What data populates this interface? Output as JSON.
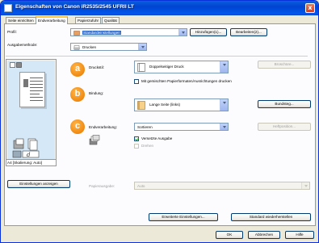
{
  "window": {
    "title": "Eigenschaften von Canon iR2535/2545 UFRII LT",
    "close_label": "x"
  },
  "tabs": [
    {
      "label": "Seite einrichten",
      "active": false
    },
    {
      "label": "Endverarbeitung",
      "active": true
    },
    {
      "label": "Papierzufuhr",
      "active": false
    },
    {
      "label": "Qualität",
      "active": false
    }
  ],
  "profile": {
    "label": "Profil:",
    "value": "Standardeinstellungen",
    "add_button": "Hinzufügen(1)...",
    "edit_button": "Bearbeiten(2)..."
  },
  "output_method": {
    "label": "Ausgabemethode:",
    "value": "Drucken"
  },
  "preview": {
    "status": "A4 [Skalierung: Auto]"
  },
  "badges": {
    "a": "a",
    "b": "b",
    "c": "c"
  },
  "print_style": {
    "label": "Druckstil:",
    "value": "Doppelseitiger Druck",
    "booklet_button": "Broschüre...",
    "mixed_checkbox_label": "Mit gemischten Papierformaten/Ausrichtungen drucken",
    "mixed_checked": false
  },
  "binding": {
    "label": "Bindung:",
    "value": "Lange Seite (links)",
    "margin_button": "Bundsteg..."
  },
  "finishing": {
    "label": "Endverarbeitung:",
    "value": "Sortieren",
    "staple_button": "Heftposition...",
    "offset_label": "Versetzte Ausgabe",
    "offset_checked": true,
    "rotate_label": "Drehen",
    "rotate_checked": false
  },
  "settings_button": "Einstellungen anzeigen",
  "paper_output": {
    "label": "Papierausgabe:",
    "value": "Auto"
  },
  "advanced_button": "Erweiterte Einstellungen...",
  "restore_button": "Standard wiederherstellen",
  "footer": {
    "ok": "OK",
    "cancel": "Abbrechen",
    "help": "Hilfe"
  },
  "colors": {
    "badge": "#f08a10",
    "titlebar": "#0054e3",
    "preview_bg": "#d4e8f8"
  }
}
